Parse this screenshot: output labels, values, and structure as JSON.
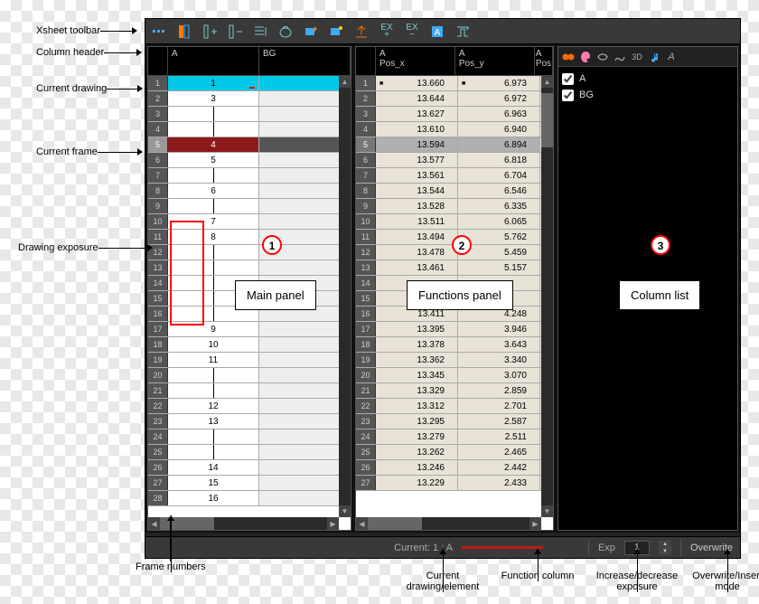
{
  "annotations": {
    "xsheet_toolbar": "Xsheet toolbar",
    "column_header": "Column header",
    "current_drawing": "Current drawing",
    "current_frame": "Current frame",
    "drawing_exposure": "Drawing exposure",
    "frame_numbers": "Frame numbers",
    "current_drawing_element": "Current drawing/element",
    "function_column": "Function column",
    "increase_decrease_exposure": "Increase/decrease exposure",
    "overwrite_insert_mode": "Overwrite/Insert mode",
    "main_panel": "Main panel",
    "functions_panel": "Functions panel",
    "column_list": "Column list",
    "marker1": "1",
    "marker2": "2",
    "marker3": "3"
  },
  "toolbar_icons": [
    "handles",
    "column-view",
    "add-column",
    "remove-column",
    "line-mode",
    "onion",
    "paint-rect",
    "paint-fill",
    "upload",
    "ex-plus",
    "ex-minus",
    "a-fill",
    "snap"
  ],
  "main": {
    "columns": [
      "A",
      "BG"
    ],
    "rows": [
      {
        "n": 1,
        "v": "1",
        "hilite": true
      },
      {
        "n": 2,
        "v": "3"
      },
      {
        "n": 3,
        "v": "",
        "line": true
      },
      {
        "n": 4,
        "v": "",
        "line": true
      },
      {
        "n": 5,
        "v": "4",
        "curframe": true
      },
      {
        "n": 6,
        "v": "5"
      },
      {
        "n": 7,
        "v": "",
        "line": true
      },
      {
        "n": 8,
        "v": "6"
      },
      {
        "n": 9,
        "v": "",
        "line": true
      },
      {
        "n": 10,
        "v": "7"
      },
      {
        "n": 11,
        "v": "8"
      },
      {
        "n": 12,
        "v": "",
        "line": true
      },
      {
        "n": 13,
        "v": "",
        "line": true
      },
      {
        "n": 14,
        "v": "",
        "line": true
      },
      {
        "n": 15,
        "v": "",
        "line": true
      },
      {
        "n": 16,
        "v": "",
        "line": true
      },
      {
        "n": 17,
        "v": "9"
      },
      {
        "n": 18,
        "v": "10"
      },
      {
        "n": 19,
        "v": "11"
      },
      {
        "n": 20,
        "v": "",
        "line": true
      },
      {
        "n": 21,
        "v": "",
        "line": true
      },
      {
        "n": 22,
        "v": "12"
      },
      {
        "n": 23,
        "v": "13"
      },
      {
        "n": 24,
        "v": "",
        "line": true
      },
      {
        "n": 25,
        "v": "",
        "line": true
      },
      {
        "n": 26,
        "v": "14"
      },
      {
        "n": 27,
        "v": "15"
      },
      {
        "n": 28,
        "v": "16"
      }
    ]
  },
  "func": {
    "col1_name": "A",
    "col1_sub": "Pos_x",
    "col2_name": "A",
    "col2_sub": "Pos_y",
    "col3_name": "A",
    "col3_sub": "Pos",
    "rows": [
      {
        "n": 1,
        "x": "13.660",
        "y": "6.973",
        "key": true
      },
      {
        "n": 2,
        "x": "13.644",
        "y": "6.972"
      },
      {
        "n": 3,
        "x": "13.627",
        "y": "6.963"
      },
      {
        "n": 4,
        "x": "13.610",
        "y": "6.940"
      },
      {
        "n": 5,
        "x": "13.594",
        "y": "6.894",
        "cur": true
      },
      {
        "n": 6,
        "x": "13.577",
        "y": "6.818"
      },
      {
        "n": 7,
        "x": "13.561",
        "y": "6.704"
      },
      {
        "n": 8,
        "x": "13.544",
        "y": "6.546"
      },
      {
        "n": 9,
        "x": "13.528",
        "y": "6.335"
      },
      {
        "n": 10,
        "x": "13.511",
        "y": "6.065"
      },
      {
        "n": 11,
        "x": "13.494",
        "y": "5.762"
      },
      {
        "n": 12,
        "x": "13.478",
        "y": "5.459"
      },
      {
        "n": 13,
        "x": "13.461",
        "y": "5.157"
      },
      {
        "n": 14,
        "x": "",
        "y": ""
      },
      {
        "n": 15,
        "x": "",
        "y": ""
      },
      {
        "n": 16,
        "x": "13.411",
        "y": "4.248"
      },
      {
        "n": 17,
        "x": "13.395",
        "y": "3.946"
      },
      {
        "n": 18,
        "x": "13.378",
        "y": "3.643"
      },
      {
        "n": 19,
        "x": "13.362",
        "y": "3.340"
      },
      {
        "n": 20,
        "x": "13.345",
        "y": "3.070"
      },
      {
        "n": 21,
        "x": "13.329",
        "y": "2.859"
      },
      {
        "n": 22,
        "x": "13.312",
        "y": "2.701"
      },
      {
        "n": 23,
        "x": "13.295",
        "y": "2.587"
      },
      {
        "n": 24,
        "x": "13.279",
        "y": "2.511"
      },
      {
        "n": 25,
        "x": "13.262",
        "y": "2.465"
      },
      {
        "n": 26,
        "x": "13.246",
        "y": "2.442"
      },
      {
        "n": 27,
        "x": "13.229",
        "y": "2.433"
      }
    ]
  },
  "collist": {
    "icons": [
      "peg",
      "art",
      "fx",
      "curve",
      "3d",
      "sound",
      "alpha"
    ],
    "labels": {
      "3d": "3D"
    },
    "items": [
      {
        "name": "A",
        "checked": true
      },
      {
        "name": "BG",
        "checked": true
      }
    ]
  },
  "status": {
    "current_label": "Current: 1 : A",
    "exp_label": "Exp",
    "exp_value": "1",
    "overwrite": "Overwrite"
  }
}
